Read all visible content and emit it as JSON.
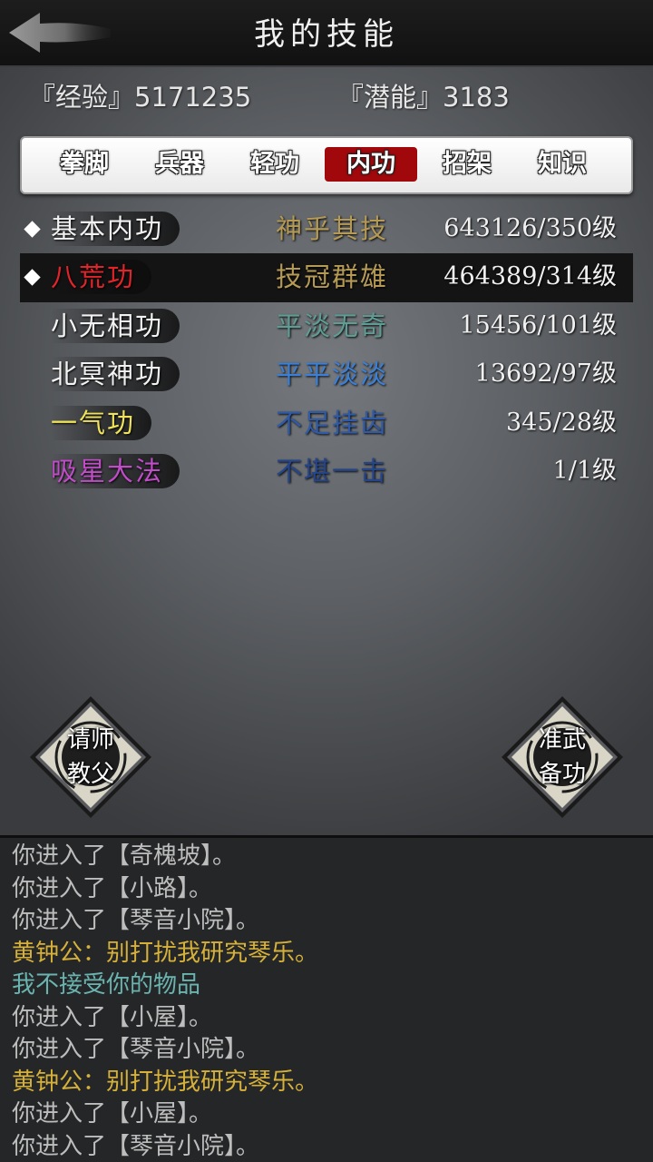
{
  "header": {
    "title": "我的技能",
    "back_icon": "arrow-left-icon"
  },
  "stats": {
    "exp": "『经验』5171235",
    "potential": "『潜能』3183"
  },
  "tabs": [
    {
      "label": "拳脚",
      "active": false
    },
    {
      "label": "兵器",
      "active": false
    },
    {
      "label": "轻功",
      "active": false
    },
    {
      "label": "内功",
      "active": true
    },
    {
      "label": "招架",
      "active": false
    },
    {
      "label": "知识",
      "active": false
    }
  ],
  "skills": [
    {
      "name": "基本内功",
      "name_color": "#f2f2f2",
      "grade": "神乎其技",
      "grade_color": "#b49a55",
      "level": "643126/350级",
      "marked": true,
      "selected": false
    },
    {
      "name": "八荒功",
      "name_color": "#e0242a",
      "grade": "技冠群雄",
      "grade_color": "#b49a55",
      "level": "464389/314级",
      "marked": true,
      "selected": true
    },
    {
      "name": "小无相功",
      "name_color": "#f2f2f2",
      "grade": "平淡无奇",
      "grade_color": "#5f9c94",
      "level": "15456/101级",
      "marked": false,
      "selected": false
    },
    {
      "name": "北冥神功",
      "name_color": "#f2f2f2",
      "grade": "平平淡淡",
      "grade_color": "#3a7fd8",
      "level": "13692/97级",
      "marked": false,
      "selected": false
    },
    {
      "name": "一气功",
      "name_color": "#efe25a",
      "grade": "不足挂齿",
      "grade_color": "#2e5aa8",
      "level": "345/28级",
      "marked": false,
      "selected": false
    },
    {
      "name": "吸星大法",
      "name_color": "#c04cc8",
      "grade": "不堪一击",
      "grade_color": "#25458a",
      "level": "1/1级",
      "marked": false,
      "selected": false
    }
  ],
  "actions": {
    "ask_master": {
      "line1": "请师",
      "line2": "教父"
    },
    "prepare": {
      "line1": "准武",
      "line2": "备功"
    }
  },
  "log": [
    {
      "text": "你进入了【奇槐坡】。",
      "color": "#bdbdbd"
    },
    {
      "text": "你进入了【小路】。",
      "color": "#bdbdbd"
    },
    {
      "text": "你进入了【琴音小院】。",
      "color": "#bdbdbd"
    },
    {
      "text": "黄钟公：别打扰我研究琴乐。",
      "color": "#d6b13a"
    },
    {
      "text": "我不接受你的物品",
      "color": "#6ab4b0"
    },
    {
      "text": "你进入了【小屋】。",
      "color": "#bdbdbd"
    },
    {
      "text": "你进入了【琴音小院】。",
      "color": "#bdbdbd"
    },
    {
      "text": "黄钟公：别打扰我研究琴乐。",
      "color": "#d6b13a"
    },
    {
      "text": "你进入了【小屋】。",
      "color": "#bdbdbd"
    },
    {
      "text": "你进入了【琴音小院】。",
      "color": "#bdbdbd"
    }
  ]
}
